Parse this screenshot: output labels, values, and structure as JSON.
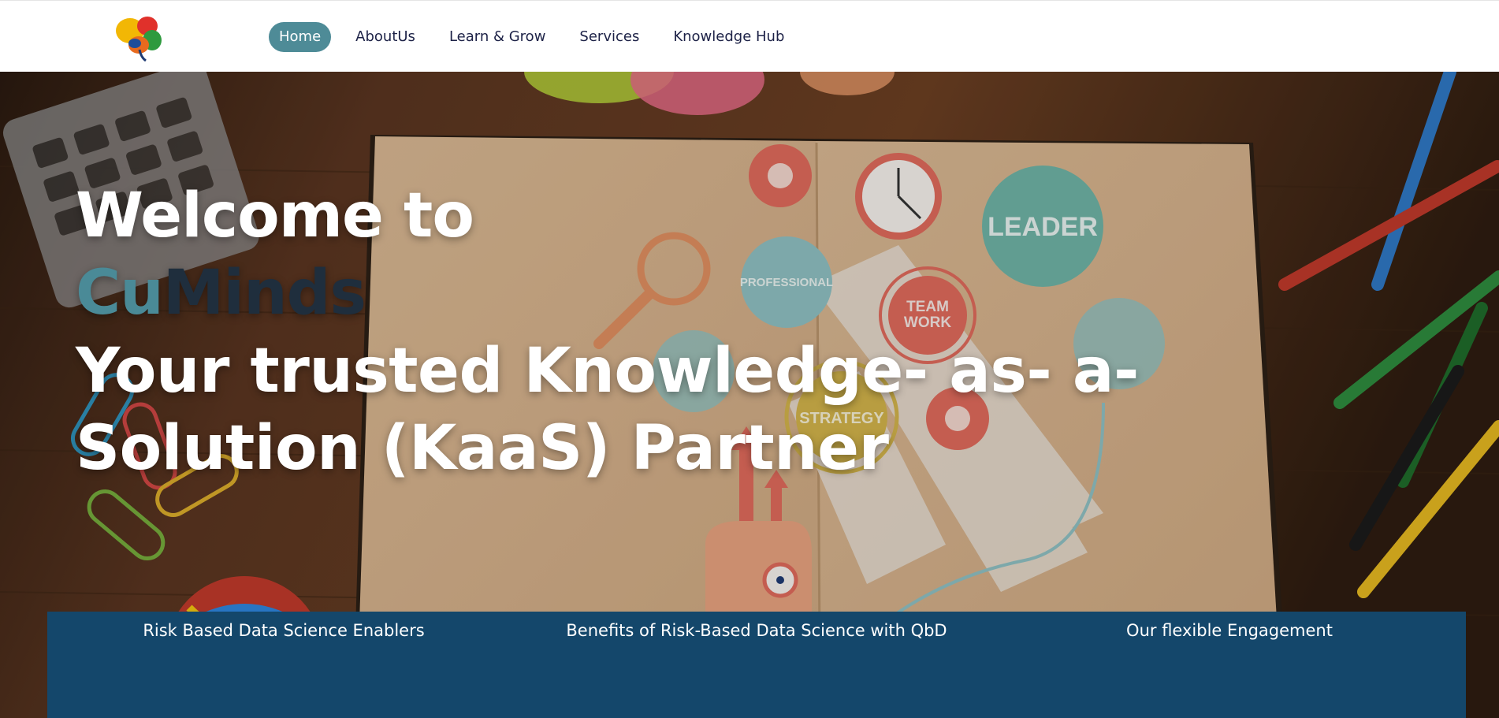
{
  "nav": {
    "items": [
      {
        "label": "Home",
        "active": true
      },
      {
        "label": "AboutUs",
        "active": false
      },
      {
        "label": "Learn & Grow",
        "active": false
      },
      {
        "label": "Services",
        "active": false
      },
      {
        "label": "Knowledge Hub",
        "active": false
      }
    ]
  },
  "hero": {
    "welcome": "Welcome to",
    "brand_cu": "Cu",
    "brand_minds": "Minds",
    "tagline": "Your trusted Knowledge- as- a-Solution (KaaS) Partner",
    "illustration_labels": {
      "leader": "LEADER",
      "professional": "PROFESSIONAL",
      "teamwork_line1": "TEAM",
      "teamwork_line2": "WORK",
      "strategy": "STRATEGY"
    }
  },
  "features": {
    "items": [
      "Risk Based Data Science Enablers",
      "Benefits of Risk-Based Data Science with QbD",
      "Our flexible Engagement"
    ]
  },
  "colors": {
    "nav_active_bg": "#4e8b97",
    "nav_text": "#1d2247",
    "brand_cu": "#4a8a97",
    "brand_minds": "#1f2e3d",
    "strip_bg": "#14476b"
  }
}
